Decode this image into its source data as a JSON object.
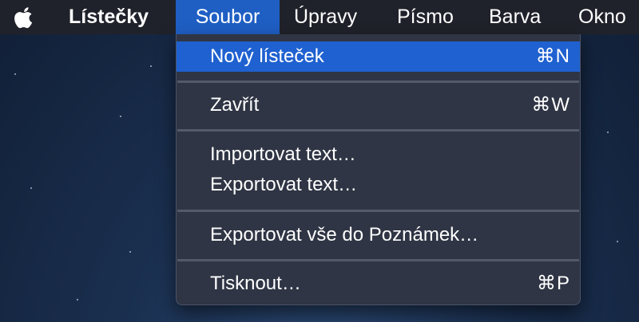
{
  "menubar": {
    "app_name": "Lístečky",
    "menus": [
      "Soubor",
      "Úpravy",
      "Písmo",
      "Barva",
      "Okno"
    ]
  },
  "dropdown": {
    "items": [
      {
        "label": "Nový lísteček",
        "shortcut": "⌘N"
      },
      {
        "label": "Zavřít",
        "shortcut": "⌘W"
      },
      {
        "label": "Importovat text…",
        "shortcut": ""
      },
      {
        "label": "Exportovat text…",
        "shortcut": ""
      },
      {
        "label": "Exportovat vše do Poznámek…",
        "shortcut": ""
      },
      {
        "label": "Tisknout…",
        "shortcut": "⌘P"
      }
    ]
  },
  "icons": {
    "apple": "apple-icon"
  },
  "colors": {
    "menubar_bg": "#20222b",
    "menu_highlight": "#1f61d0",
    "dropdown_bg": "#2f3544"
  }
}
